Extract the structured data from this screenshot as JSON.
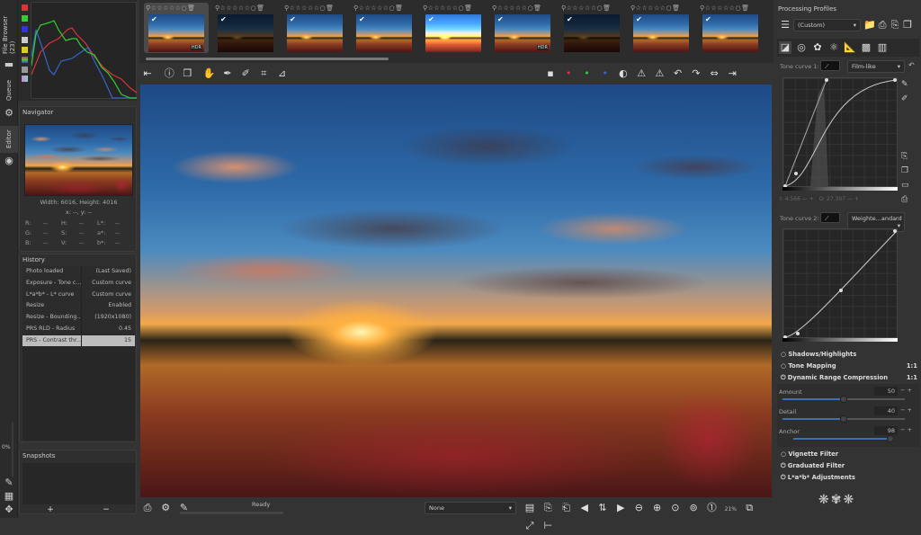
{
  "sidebar_tabs": {
    "file_browser": "File Browser (23)",
    "queue": "Queue",
    "editor": "Editor",
    "progress": "0%"
  },
  "navigator": {
    "title": "Navigator",
    "dimensions": "Width: 6016, Height: 4016",
    "coords": "x: --, y: --",
    "readouts": [
      [
        "R:",
        "--",
        "H:",
        "--",
        "L*:",
        "--"
      ],
      [
        "G:",
        "--",
        "S:",
        "--",
        "a*:",
        "--"
      ],
      [
        "B:",
        "--",
        "V:",
        "--",
        "b*:",
        "--"
      ]
    ]
  },
  "history": {
    "title": "History",
    "items": [
      {
        "action": "Photo loaded",
        "value": "(Last Saved)"
      },
      {
        "action": "Exposure - Tone c...",
        "value": "Custom curve"
      },
      {
        "action": "L*a*b* - L* curve",
        "value": "Custom curve"
      },
      {
        "action": "Resize",
        "value": "Enabled"
      },
      {
        "action": "Resize - Bounding...",
        "value": "(1920x1080)"
      },
      {
        "action": "PRS RLD - Radius",
        "value": "0.45"
      },
      {
        "action": "PRS - Contrast thr...",
        "value": "15",
        "selected": true
      }
    ]
  },
  "snapshots": {
    "title": "Snapshots",
    "add": "+",
    "remove": "−"
  },
  "filmstrip": {
    "thumbnails": [
      {
        "hdr": "HDR",
        "selected": true
      },
      {},
      {},
      {},
      {},
      {
        "hdr": "HDR"
      },
      {},
      {},
      {}
    ],
    "hdr_label": "HDR",
    "rating": "☆☆☆☆☆"
  },
  "statusbar": {
    "status": "Ready",
    "profile_select": "None",
    "zoom": "21%"
  },
  "right": {
    "title": "Processing Profiles",
    "profile": "(Custom)",
    "tone_curve_1": {
      "label": "Tone curve 1:",
      "mode": "Film-like",
      "in_label": "I:",
      "in_val": "4.566",
      "out_label": "O:",
      "out_val": "27.397"
    },
    "tone_curve_2": {
      "label": "Tone curve 2:",
      "mode": "Weighte...andard"
    },
    "sections": {
      "shadows": "Shadows/Highlights",
      "tonemap": "Tone Mapping",
      "drc": "Dynamic Range Compression",
      "ratio": "1:1",
      "vignette": "Vignette Filter",
      "graduated": "Graduated Filter",
      "lab": "L*a*b* Adjustments"
    },
    "sliders": [
      {
        "label": "Amount",
        "value": "50",
        "fraction": 0.5
      },
      {
        "label": "Detail",
        "value": "40",
        "fraction": 0.5
      },
      {
        "label": "Anchor",
        "value": "98",
        "fraction": 0.98
      }
    ]
  },
  "colors": {
    "accent": "#3d6fb3",
    "selection": "#bdbdbd"
  }
}
